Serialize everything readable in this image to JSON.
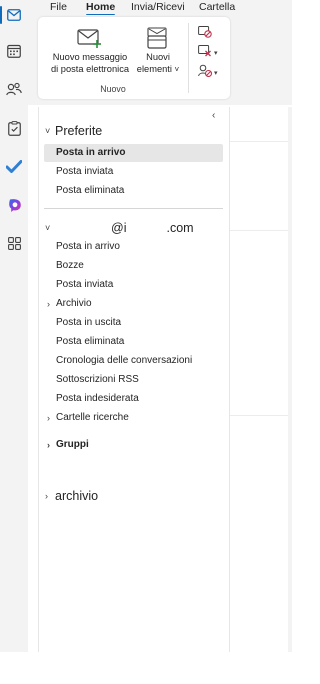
{
  "menu": {
    "tabs": [
      {
        "label": "File"
      },
      {
        "label": "Home"
      },
      {
        "label": "Invia/Ricevi"
      },
      {
        "label": "Cartella"
      }
    ],
    "active": "Home"
  },
  "ribbon": {
    "new_message_line1": "Nuovo messaggio",
    "new_message_line2": "di posta elettronica",
    "new_items_line1": "Nuovi",
    "new_items_line2": "elementi",
    "new_items_caret": "˅",
    "group_label": "Nuovo"
  },
  "rail": {
    "items": [
      "mail-icon",
      "calendar-icon",
      "people-icon",
      "tasks-icon",
      "todo-icon",
      "copilot-icon",
      "apps-icon"
    ],
    "accent": "#0f6cbd"
  },
  "folders": {
    "collapse_glyph": "‹",
    "favorites": {
      "label": "Preferite",
      "chevron": "˅",
      "items": [
        "Posta in arrivo",
        "Posta inviata",
        "Posta eliminata"
      ]
    },
    "account": {
      "label_middle": "@i",
      "label_suffix": ".com",
      "chevron": "˅",
      "items": [
        {
          "label": "Posta in arrivo",
          "expandable": false
        },
        {
          "label": "Bozze",
          "expandable": false
        },
        {
          "label": "Posta inviata",
          "expandable": false
        },
        {
          "label": "Archivio",
          "expandable": true
        },
        {
          "label": "Posta in uscita",
          "expandable": false
        },
        {
          "label": "Posta eliminata",
          "expandable": false
        },
        {
          "label": "Cronologia delle conversazioni",
          "expandable": false
        },
        {
          "label": "Sottoscrizioni RSS",
          "expandable": false
        },
        {
          "label": "Posta indesiderata",
          "expandable": false
        },
        {
          "label": "Cartelle ricerche",
          "expandable": true
        }
      ]
    },
    "groups": {
      "label": "Gruppi",
      "chevron": "›"
    },
    "archive_account": {
      "label": "archivio",
      "chevron": "›"
    }
  }
}
